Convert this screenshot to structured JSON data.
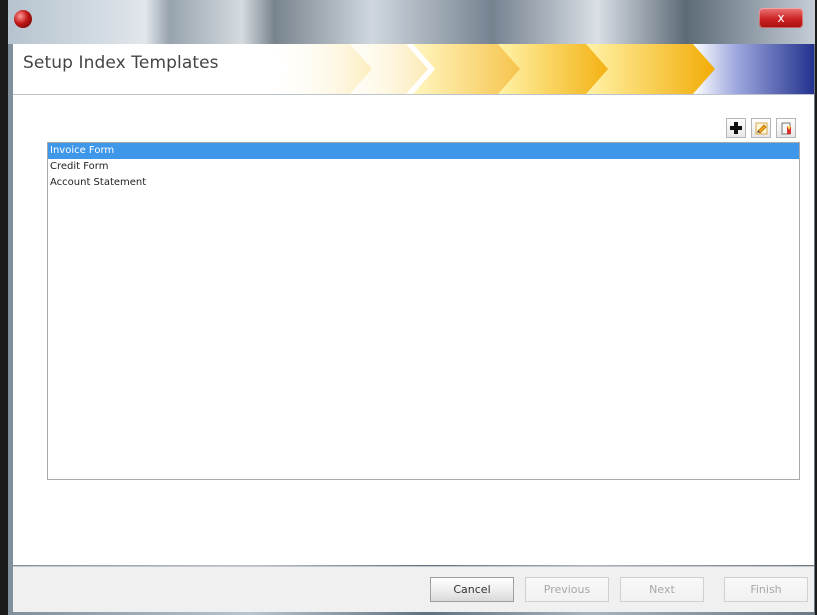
{
  "window": {
    "title": "Setup Index Templates",
    "close_label": "x"
  },
  "toolbar": {
    "actions": [
      {
        "name": "add-template-button",
        "icon": "plus-icon"
      },
      {
        "name": "edit-template-button",
        "icon": "edit-icon"
      },
      {
        "name": "delete-template-button",
        "icon": "delete-icon"
      }
    ]
  },
  "templates": {
    "items": [
      {
        "label": "Invoice Form",
        "selected": true
      },
      {
        "label": "Credit Form",
        "selected": false
      },
      {
        "label": "Account Statement",
        "selected": false
      }
    ]
  },
  "footer": {
    "cancel": "Cancel",
    "previous": "Previous",
    "next": "Next",
    "finish": "Finish"
  },
  "colors": {
    "selection": "#3f97ea",
    "banner_yellow": "#f6b500",
    "banner_blue": "#23328e"
  }
}
